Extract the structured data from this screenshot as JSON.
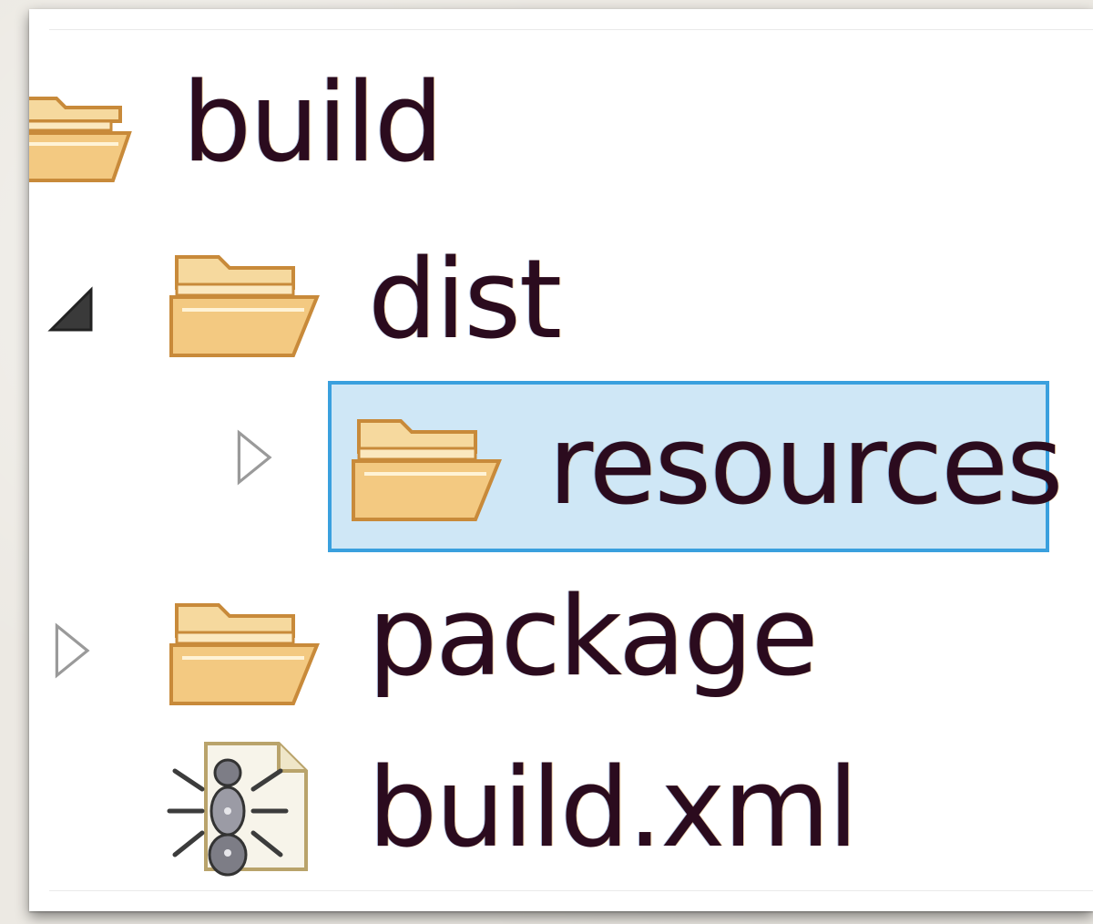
{
  "tree": {
    "items": [
      {
        "label": "build",
        "icon": "folder-open-icon",
        "expander": "none"
      },
      {
        "label": "dist",
        "icon": "folder-open-icon",
        "expander": "expanded"
      },
      {
        "label": "resources",
        "icon": "folder-open-icon",
        "expander": "collapsed",
        "selected": true
      },
      {
        "label": "package",
        "icon": "folder-open-icon",
        "expander": "collapsed"
      },
      {
        "label": "build.xml",
        "icon": "ant-build-file-icon",
        "expander": "none"
      }
    ]
  },
  "colors": {
    "selection_border": "#3aa0de",
    "selection_fill": "#cfe7f6",
    "label_text": "#2b0b1e",
    "folder_fill": "#f3c981",
    "folder_stroke": "#c88a3a"
  }
}
